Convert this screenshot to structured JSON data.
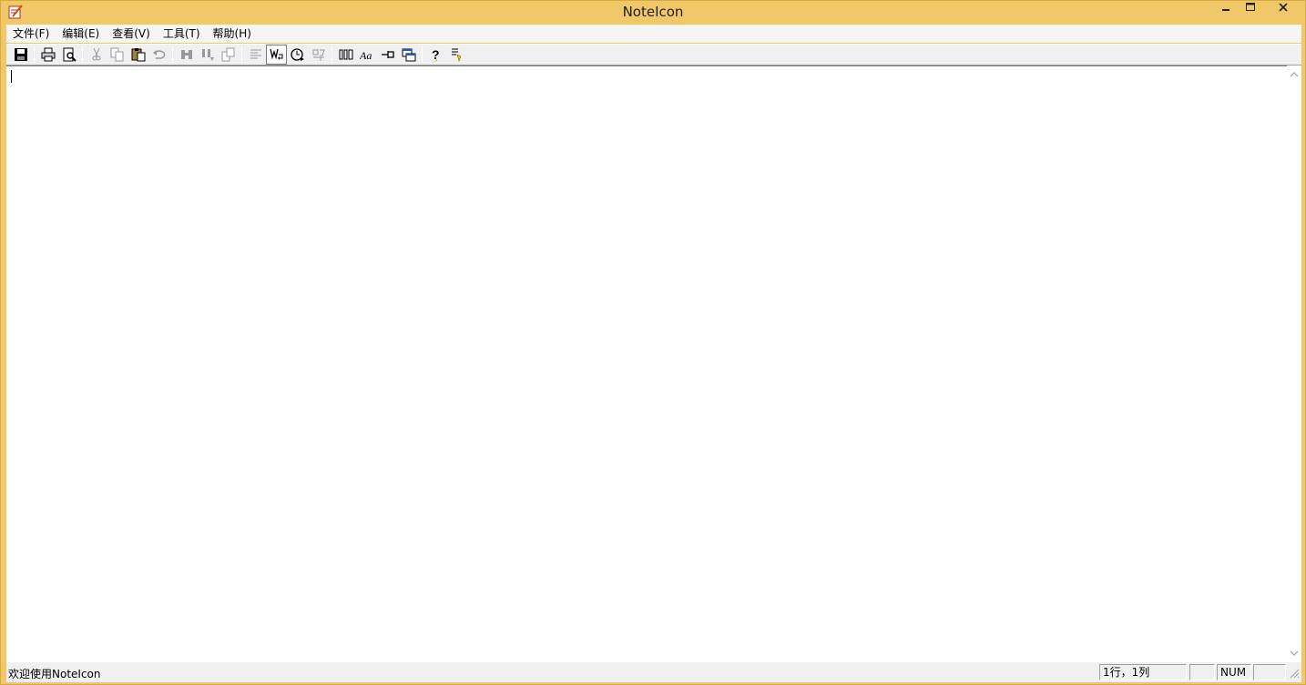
{
  "window": {
    "title": "NoteIcon",
    "frame_color": "#f0c86a",
    "controls": {
      "minimize_icon": "minimize-icon",
      "maximize_icon": "maximize-icon",
      "close_icon": "close-icon"
    }
  },
  "menu": {
    "items": [
      {
        "label": "文件(F)"
      },
      {
        "label": "编辑(E)"
      },
      {
        "label": "查看(V)"
      },
      {
        "label": "工具(T)"
      },
      {
        "label": "帮助(H)"
      }
    ]
  },
  "toolbar": {
    "buttons": [
      {
        "icon": "save-icon",
        "enabled": true
      },
      {
        "icon": "print-icon",
        "enabled": true
      },
      {
        "icon": "print-preview-icon",
        "enabled": true
      },
      {
        "icon": "cut-icon",
        "enabled": false
      },
      {
        "icon": "copy-icon",
        "enabled": false
      },
      {
        "icon": "paste-icon",
        "enabled": true
      },
      {
        "icon": "undo-icon",
        "enabled": false
      },
      {
        "icon": "find-icon",
        "enabled": false
      },
      {
        "icon": "find-next-icon",
        "enabled": false
      },
      {
        "icon": "replace-icon",
        "enabled": false
      },
      {
        "icon": "align-left-icon",
        "enabled": false
      },
      {
        "icon": "word-wrap-icon",
        "enabled": true,
        "pressed": true
      },
      {
        "icon": "auto-save-icon",
        "enabled": true
      },
      {
        "icon": "encoding-icon",
        "enabled": false
      },
      {
        "icon": "columns-icon",
        "enabled": true
      },
      {
        "icon": "font-icon",
        "enabled": true
      },
      {
        "icon": "pin-icon",
        "enabled": true
      },
      {
        "icon": "window-icon",
        "enabled": true
      },
      {
        "icon": "help-icon",
        "enabled": true
      },
      {
        "icon": "context-help-icon",
        "enabled": true
      }
    ]
  },
  "editor": {
    "content": ""
  },
  "status": {
    "message": "欢迎使用NoteIcon",
    "position": "1行，1列",
    "num": "NUM"
  }
}
